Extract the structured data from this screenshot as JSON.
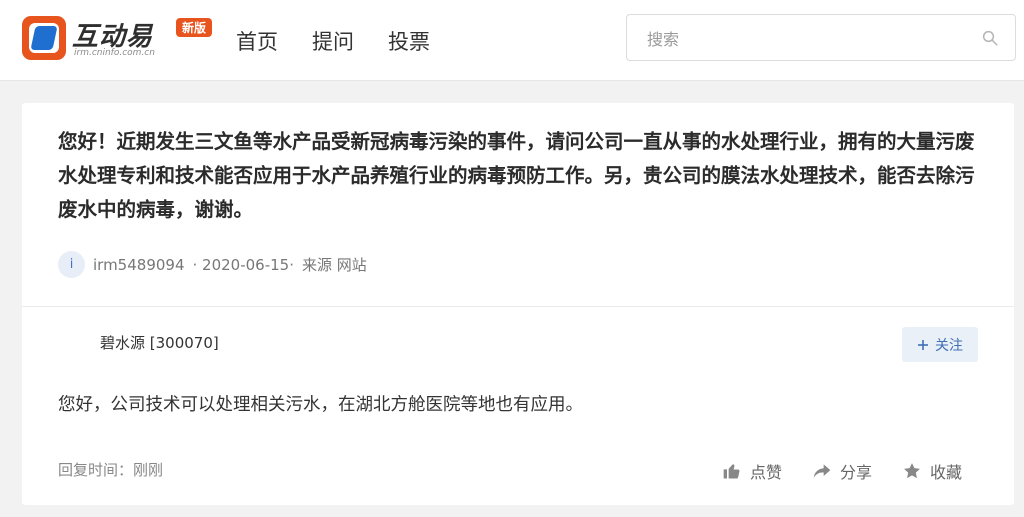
{
  "header": {
    "logo_text": "互动易",
    "logo_sub": "irm.cninfo.com.cn",
    "logo_badge": "新版",
    "nav": [
      "首页",
      "提问",
      "投票"
    ],
    "search_placeholder": "搜索"
  },
  "question": {
    "text": "您好！近期发生三文鱼等水产品受新冠病毒污染的事件，请问公司一直从事的水处理行业，拥有的大量污废水处理专利和技术能否应用于水产品养殖行业的病毒预防工作。另，贵公司的膜法水处理技术，能否去除污废水中的病毒，谢谢。",
    "avatar_letter": "i",
    "user": "irm5489094",
    "date": "· 2020-06-15·",
    "source": "来源 网站"
  },
  "reply": {
    "company": "碧水源 [300070]",
    "follow_label": "关注",
    "answer": "您好，公司技术可以处理相关污水，在湖北方舱医院等地也有应用。",
    "reply_time": "回复时间：刚刚",
    "like_label": "点赞",
    "share_label": "分享",
    "collect_label": "收藏"
  },
  "colors": {
    "brand_orange": "#e8541e",
    "accent_blue": "#3f6fb5",
    "background": "#f2f2f2"
  }
}
